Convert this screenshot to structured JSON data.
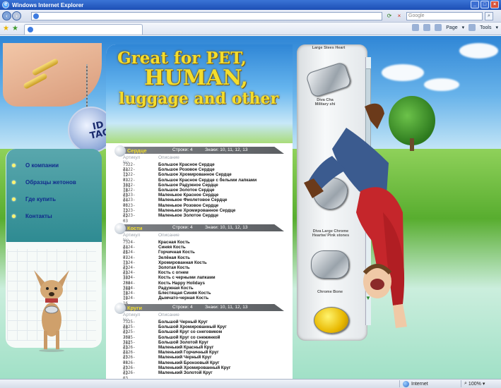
{
  "window": {
    "title": "Windows Internet Explorer",
    "min": "_",
    "max": "□",
    "close": "×"
  },
  "address": {
    "url": "",
    "search_placeholder": "Google"
  },
  "toolbar": {
    "page_label": "Page",
    "tools_label": "Tools"
  },
  "status": {
    "zone": "Internet",
    "zoom": "100%"
  },
  "banner": {
    "line1": "Great for PET,",
    "line2": "HUMAN,",
    "line3": "luggage and other"
  },
  "logo": {
    "line1": "ID",
    "line2": "TAG"
  },
  "menu": [
    {
      "label": "О компании"
    },
    {
      "label": "Образцы жетонов"
    },
    {
      "label": "Где купить"
    },
    {
      "label": "Контакты"
    }
  ],
  "columns": {
    "article": "Артикул No",
    "desc": "Описание"
  },
  "sections": [
    {
      "name": "Сердце",
      "rows": "Строки: 4",
      "sizes": "Знаки: 10, 11, 12, 13",
      "items": [
        [
          "7322-04",
          "Большое Красное Сердце"
        ],
        [
          "7322-12",
          "Большое Розовое Сердце"
        ],
        [
          "7322-02",
          "Большое Хромированное Сердце"
        ],
        [
          "7322-301",
          "Большое Красное Сердце с белыми лапками"
        ],
        [
          "7322-18",
          "Большое Радужное Сердце"
        ],
        [
          "7322-03",
          "Большое Золотое Сердце"
        ],
        [
          "7323-04",
          "Маленькое Красное Сердце"
        ],
        [
          "7323-06",
          "Маленькое Фиолетовое Сердце"
        ],
        [
          "7323-12",
          "Маленькое Розовое Сердце"
        ],
        [
          "7323-02",
          "Маленькое Хромированное Сердце"
        ],
        [
          "7323-03",
          "Маленькое Золотое Сердце"
        ]
      ]
    },
    {
      "name": "Кости",
      "rows": "Строки: 4",
      "sizes": "Знаки: 10, 11, 12, 13",
      "items": [
        [
          "7324-04",
          "Красная Кость"
        ],
        [
          "7324-05",
          "Синяя Кость"
        ],
        [
          "7324-07",
          "Горчичная Кость"
        ],
        [
          "7324-13",
          "Зелёная Кость"
        ],
        [
          "7324-02",
          "Хромированная Кость"
        ],
        [
          "7324-03",
          "Золотая Кость"
        ],
        [
          "7324-307",
          "Кость с огнем"
        ],
        [
          "7324-286",
          "Кость с черными лапками"
        ],
        [
          "7324-268",
          "Кость Happy Holidays"
        ],
        [
          "7324-18",
          "Радужная Кость"
        ],
        [
          "7324-19",
          "Блестящая Синяя Кость"
        ],
        [
          "7324-16",
          "Дымчато-черная Кость"
        ]
      ]
    },
    {
      "name": "Круги",
      "rows": "Строки: 4",
      "sizes": "Знаки: 10, 11, 12, 13",
      "items": [
        [
          "7325-08",
          "Большой Черный Круг"
        ],
        [
          "7325-02",
          "Большой Хромированный Круг"
        ],
        [
          "7325-368",
          "Большой Круг со снеговиком"
        ],
        [
          "7325-261",
          "Большой Круг со снежинкой"
        ],
        [
          "7325-03",
          "Большой Золотой Круг"
        ],
        [
          "7326-04",
          "Маленький Красный Круг"
        ],
        [
          "7326-07",
          "Маленький Горчичный Круг"
        ],
        [
          "7326-08",
          "Маленький Черный Круг"
        ],
        [
          "7326-07",
          "Маленький Бронзовый Круг"
        ],
        [
          "7326-02",
          "Маленький Хромированный Круг"
        ],
        [
          "7326-03",
          "Маленький Золотой Круг"
        ]
      ]
    }
  ],
  "products": [
    {
      "caption": "Diva Cha Military shi",
      "extra": "Large Stees Heart"
    },
    {
      "caption": "Diva Large Chrome Heartw/ Pink stones"
    },
    {
      "caption": "Chrome Bone"
    }
  ],
  "colors": {
    "menu_text": "#102a8c",
    "section_title": "#f3df2a",
    "headline": "#f4dd2c"
  }
}
